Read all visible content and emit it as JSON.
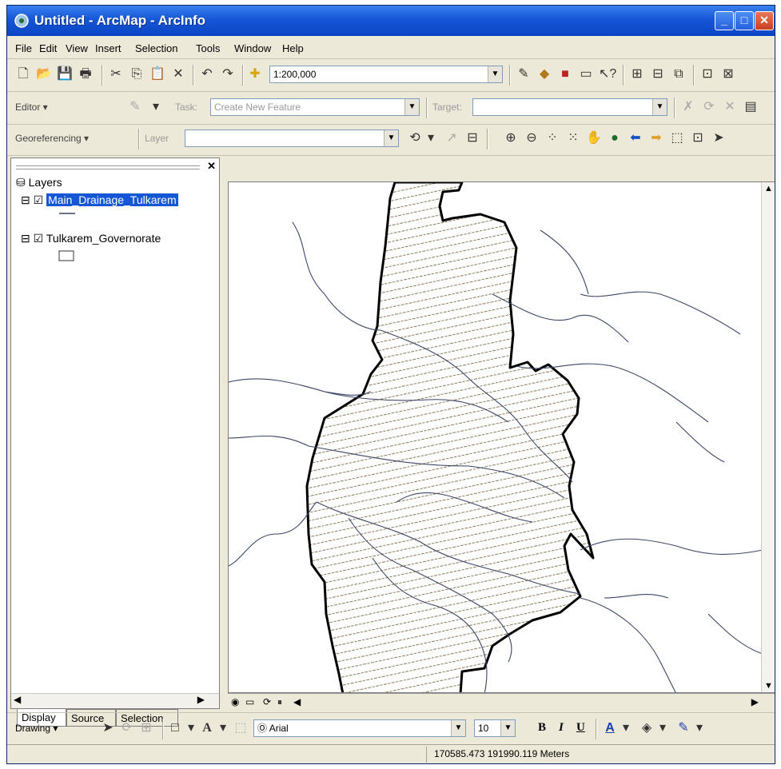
{
  "window": {
    "title": "Untitled - ArcMap - ArcInfo"
  },
  "menu": [
    "File",
    "Edit",
    "View",
    "Insert",
    "Selection",
    "Tools",
    "Window",
    "Help"
  ],
  "standard_toolbar": {
    "scale": "1:200,000"
  },
  "editor_toolbar": {
    "editor_label": "Editor ▾",
    "task_label": "Task:",
    "task_value": "Create New Feature",
    "target_label": "Target:",
    "target_value": ""
  },
  "georef_toolbar": {
    "label": "Georeferencing ▾",
    "layer_label": "Layer",
    "layer_value": ""
  },
  "toc": {
    "root": "Layers",
    "layers": [
      {
        "name": "Main_Drainage_Tulkarem",
        "checked": true,
        "selected": true
      },
      {
        "name": "Tulkarem_Governorate",
        "checked": true,
        "selected": false
      }
    ],
    "tabs": [
      "Display",
      "Source",
      "Selection"
    ]
  },
  "drawing_toolbar": {
    "drawing_label": "Drawing ▾",
    "font": "Arial",
    "font_size": "10",
    "bold": "B",
    "italic": "I",
    "underline": "U"
  },
  "status": {
    "coordinates": "170585.473  191990.119 Meters"
  },
  "colors": {
    "title_bar": "#1556d6",
    "boundary": "#000000",
    "rivers": "#3a4568",
    "hatch": "#8a7a5a"
  }
}
